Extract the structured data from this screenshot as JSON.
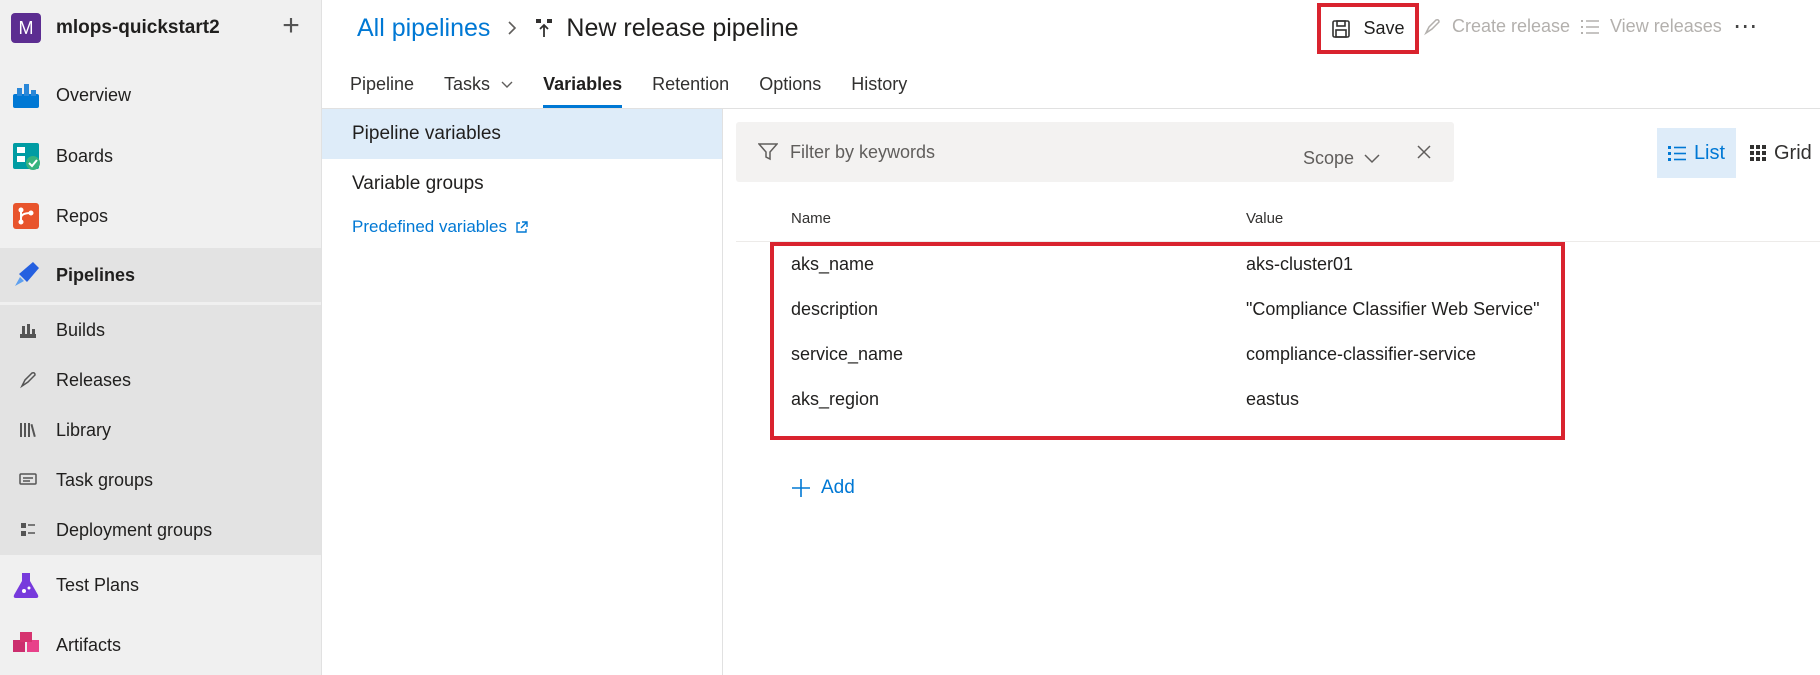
{
  "project": {
    "initial": "M",
    "name": "mlops-quickstart2",
    "color": "#5c2d91"
  },
  "nav": {
    "overview": "Overview",
    "boards": "Boards",
    "repos": "Repos",
    "pipelines": "Pipelines",
    "builds": "Builds",
    "releases": "Releases",
    "library": "Library",
    "task_groups": "Task groups",
    "deployment_groups": "Deployment groups",
    "test_plans": "Test Plans",
    "artifacts": "Artifacts"
  },
  "header": {
    "crumb_link": "All pipelines",
    "title": "New release pipeline",
    "save": "Save",
    "create_release": "Create release",
    "view_releases": "View releases",
    "more": "⋯"
  },
  "tabs": {
    "pipeline": "Pipeline",
    "tasks": "Tasks",
    "variables": "Variables",
    "retention": "Retention",
    "options": "Options",
    "history": "History"
  },
  "left_panel": {
    "pipeline_variables": "Pipeline variables",
    "variable_groups": "Variable groups",
    "predefined_variables": "Predefined variables"
  },
  "filter": {
    "placeholder": "Filter by keywords",
    "scope": "Scope"
  },
  "view": {
    "list": "List",
    "grid": "Grid"
  },
  "table": {
    "col_name": "Name",
    "col_value": "Value",
    "rows": [
      {
        "name": "aks_name",
        "value": "aks-cluster01"
      },
      {
        "name": "description",
        "value": "\"Compliance Classifier Web Service\""
      },
      {
        "name": "service_name",
        "value": "compliance-classifier-service"
      },
      {
        "name": "aks_region",
        "value": "eastus"
      }
    ]
  },
  "add_label": "Add",
  "colors": {
    "accent": "#0078d4",
    "highlight": "#d9232e",
    "selected_bg": "#deecf9"
  }
}
